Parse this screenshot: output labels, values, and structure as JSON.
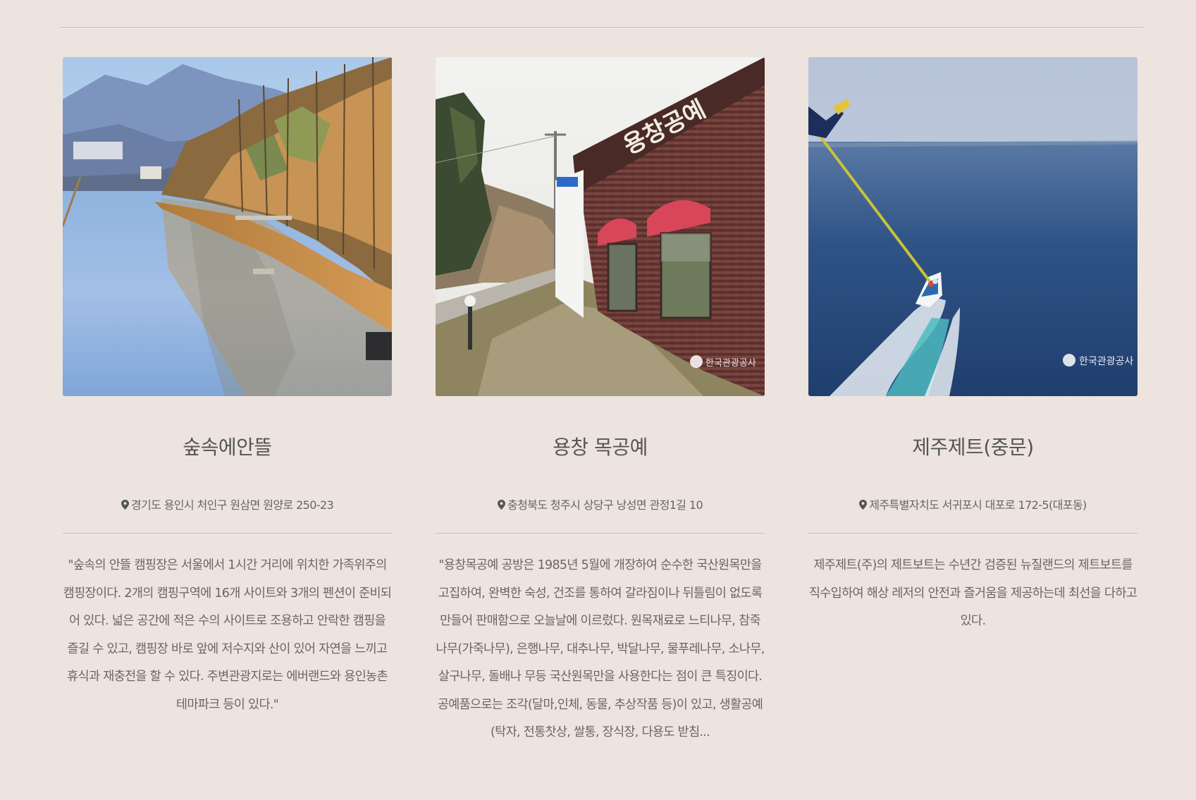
{
  "cards": [
    {
      "image_alt": "",
      "title": "숲속에안뜰",
      "address": "경기도 용인시 처인구 원삼면 원양로 250-23",
      "description": "\"숲속의 안뜰 캠핑장은 서울에서 1시간 거리에 위치한 가족위주의 캠핑장이다. 2개의 캠핑구역에 16개 사이트와 3개의 펜션이 준비되어 있다. 넓은 공간에 적은 수의 사이트로 조용하고 안락한 캠핑을 즐길 수 있고, 캠핑장 바로 앞에 저수지와 산이 있어 자연을 느끼고 휴식과 재충전을 할 수 있다. 주변관광지로는 에버랜드와 용인농촌테마파크 등이 있다.\""
    },
    {
      "image_sign": "용창공예",
      "image_watermark": "한국관광공사",
      "title": "용창 목공예",
      "address": "충청북도 청주시 상당구 낭성면 관정1길 10",
      "description": "\"용창목공예 공방은 1985년 5월에 개장하여 순수한 국산원목만을 고집하여, 완벽한 숙성, 건조를 통하여 갈라짐이나 뒤틀림이 없도록 만들어 판매함으로 오늘날에 이르렀다. 원목재료로 느티나무, 참죽나무(가죽나무), 은행나무, 대추나무, 박달나무, 물푸레나무, 소나무, 살구나무, 돌배나 무등 국산원목만을 사용한다는 점이 큰 특징이다. 공예품으로는 조각(달마,인체, 동물, 추상작품 등)이 있고, 생활공예(탁자, 전통찻상, 쌀통, 장식장, 다용도 받침..."
    },
    {
      "image_watermark": "한국관광공사",
      "title": "제주제트(중문)",
      "address": "제주특별자치도 서귀포시 대포로 172-5(대포동)",
      "description": "제주제트(주)의 제트보트는 수년간 검증된 뉴질랜드의 제트보트를 직수입하여 해상 레저의 안전과 즐거움을 제공하는데 최선을 다하고 있다."
    }
  ],
  "colors": {
    "background": "#ede4df",
    "text": "#5a5552",
    "divider": "#d8ceca"
  },
  "icons": {
    "address": "map-pin-icon"
  }
}
